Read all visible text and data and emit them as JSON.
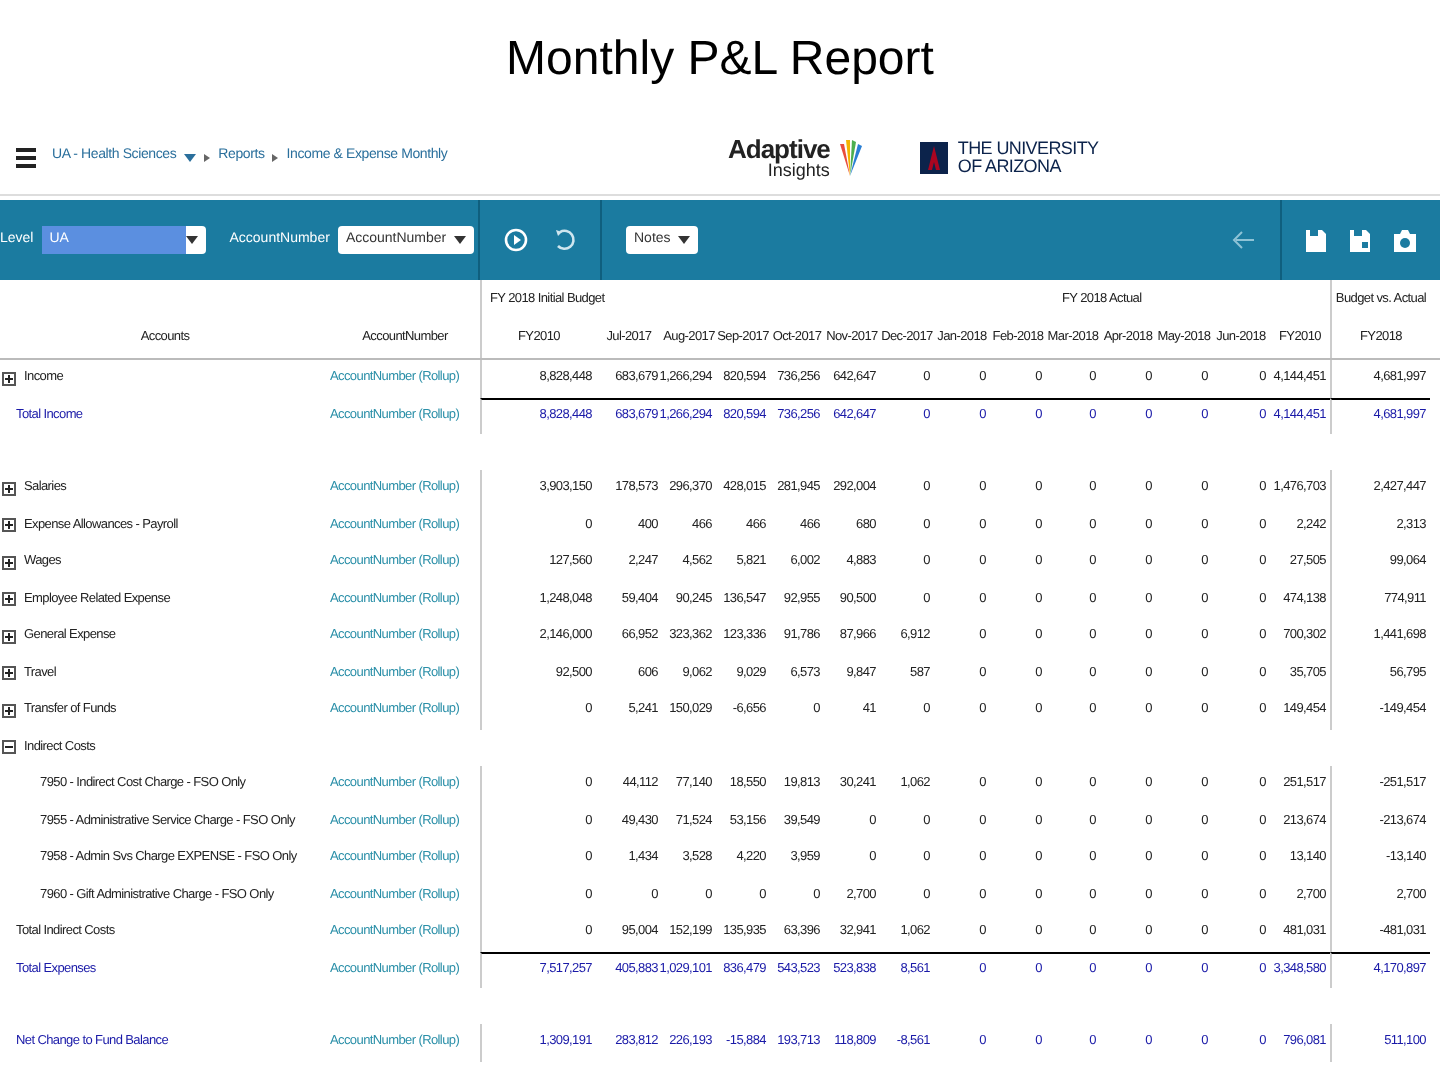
{
  "slide_title": "Monthly P&L Report",
  "header": {
    "breadcrumb": [
      "UA - Health Sciences",
      "Reports",
      "Income & Expense Monthly"
    ],
    "logo_adaptive": [
      "Adaptive",
      "Insights"
    ],
    "logo_university": [
      "THE UNIVERSITY",
      "OF ARIZONA"
    ]
  },
  "toolbar": {
    "level_label": "Level",
    "level_value": "UA",
    "account_label": "AccountNumber",
    "account_value": "AccountNumber",
    "notes": "Notes"
  },
  "table": {
    "column_groups": [
      "FY 2018 Initial Budget",
      "FY 2018 Actual",
      "Budget vs. Actual"
    ],
    "columns": [
      "Accounts",
      "AccountNumber",
      "FY2010",
      "Jul-2017",
      "Aug-2017",
      "Sep-2017",
      "Oct-2017",
      "Nov-2017",
      "Dec-2017",
      "Jan-2018",
      "Feb-2018",
      "Mar-2018",
      "Apr-2018",
      "May-2018",
      "Jun-2018",
      "FY2010",
      "FY2018"
    ],
    "rows": [
      {
        "kind": "group",
        "expanded": false,
        "account": "Income",
        "number": "AccountNumber (Rollup)",
        "values": [
          "8,828,448",
          "683,679",
          "1,266,294",
          "820,594",
          "736,256",
          "642,647",
          "0",
          "0",
          "0",
          "0",
          "0",
          "0",
          "0",
          "4,144,451",
          "4,681,997"
        ]
      },
      {
        "kind": "total",
        "rule_above": true,
        "account": "Total Income",
        "number": "AccountNumber (Rollup)",
        "values": [
          "8,828,448",
          "683,679",
          "1,266,294",
          "820,594",
          "736,256",
          "642,647",
          "0",
          "0",
          "0",
          "0",
          "0",
          "0",
          "0",
          "4,144,451",
          "4,681,997"
        ]
      },
      {
        "kind": "group",
        "gap_before": true,
        "expanded": false,
        "account": "Salaries",
        "number": "AccountNumber (Rollup)",
        "values": [
          "3,903,150",
          "178,573",
          "296,370",
          "428,015",
          "281,945",
          "292,004",
          "0",
          "0",
          "0",
          "0",
          "0",
          "0",
          "0",
          "1,476,703",
          "2,427,447"
        ]
      },
      {
        "kind": "group",
        "expanded": false,
        "account": "Expense Allowances - Payroll",
        "number": "AccountNumber (Rollup)",
        "values": [
          "0",
          "400",
          "466",
          "466",
          "466",
          "680",
          "0",
          "0",
          "0",
          "0",
          "0",
          "0",
          "0",
          "2,242",
          "2,313"
        ]
      },
      {
        "kind": "group",
        "expanded": false,
        "account": "Wages",
        "number": "AccountNumber (Rollup)",
        "values": [
          "127,560",
          "2,247",
          "4,562",
          "5,821",
          "6,002",
          "4,883",
          "0",
          "0",
          "0",
          "0",
          "0",
          "0",
          "0",
          "27,505",
          "99,064"
        ]
      },
      {
        "kind": "group",
        "expanded": false,
        "account": "Employee Related Expense",
        "number": "AccountNumber (Rollup)",
        "values": [
          "1,248,048",
          "59,404",
          "90,245",
          "136,547",
          "92,955",
          "90,500",
          "0",
          "0",
          "0",
          "0",
          "0",
          "0",
          "0",
          "474,138",
          "774,911"
        ]
      },
      {
        "kind": "group",
        "expanded": false,
        "account": "General Expense",
        "number": "AccountNumber (Rollup)",
        "values": [
          "2,146,000",
          "66,952",
          "323,362",
          "123,336",
          "91,786",
          "87,966",
          "6,912",
          "0",
          "0",
          "0",
          "0",
          "0",
          "0",
          "700,302",
          "1,441,698"
        ]
      },
      {
        "kind": "group",
        "expanded": false,
        "account": "Travel",
        "number": "AccountNumber (Rollup)",
        "values": [
          "92,500",
          "606",
          "9,062",
          "9,029",
          "6,573",
          "9,847",
          "587",
          "0",
          "0",
          "0",
          "0",
          "0",
          "0",
          "35,705",
          "56,795"
        ]
      },
      {
        "kind": "group",
        "expanded": false,
        "account": "Transfer of Funds",
        "number": "AccountNumber (Rollup)",
        "values": [
          "0",
          "5,241",
          "150,029",
          "-6,656",
          "0",
          "41",
          "0",
          "0",
          "0",
          "0",
          "0",
          "0",
          "0",
          "149,454",
          "-149,454"
        ]
      },
      {
        "kind": "group",
        "expanded": true,
        "account": "Indirect Costs"
      },
      {
        "kind": "child",
        "account": "7950 - Indirect Cost Charge - FSO Only",
        "number": "AccountNumber (Rollup)",
        "values": [
          "0",
          "44,112",
          "77,140",
          "18,550",
          "19,813",
          "30,241",
          "1,062",
          "0",
          "0",
          "0",
          "0",
          "0",
          "0",
          "251,517",
          "-251,517"
        ]
      },
      {
        "kind": "child",
        "account": "7955 - Administrative Service Charge - FSO Only",
        "number": "AccountNumber (Rollup)",
        "values": [
          "0",
          "49,430",
          "71,524",
          "53,156",
          "39,549",
          "0",
          "0",
          "0",
          "0",
          "0",
          "0",
          "0",
          "0",
          "213,674",
          "-213,674"
        ]
      },
      {
        "kind": "child",
        "account": "7958 - Admin Svs Charge EXPENSE - FSO Only",
        "number": "AccountNumber (Rollup)",
        "values": [
          "0",
          "1,434",
          "3,528",
          "4,220",
          "3,959",
          "0",
          "0",
          "0",
          "0",
          "0",
          "0",
          "0",
          "0",
          "13,140",
          "-13,140"
        ]
      },
      {
        "kind": "child",
        "account": "7960 - Gift Administrative Charge - FSO Only",
        "number": "AccountNumber (Rollup)",
        "values": [
          "0",
          "0",
          "0",
          "0",
          "0",
          "2,700",
          "0",
          "0",
          "0",
          "0",
          "0",
          "0",
          "0",
          "2,700",
          "2,700"
        ]
      },
      {
        "kind": "subtotal",
        "account": "Total Indirect Costs",
        "number": "AccountNumber (Rollup)",
        "values": [
          "0",
          "95,004",
          "152,199",
          "135,935",
          "63,396",
          "32,941",
          "1,062",
          "0",
          "0",
          "0",
          "0",
          "0",
          "0",
          "481,031",
          "-481,031"
        ]
      },
      {
        "kind": "total",
        "rule_above": true,
        "account": "Total Expenses",
        "number": "AccountNumber (Rollup)",
        "values": [
          "7,517,257",
          "405,883",
          "1,029,101",
          "836,479",
          "543,523",
          "523,838",
          "8,561",
          "0",
          "0",
          "0",
          "0",
          "0",
          "0",
          "3,348,580",
          "4,170,897"
        ]
      },
      {
        "kind": "total",
        "gap_before": true,
        "account": "Net Change to Fund Balance",
        "number": "AccountNumber (Rollup)",
        "values": [
          "1,309,191",
          "283,812",
          "226,193",
          "-15,884",
          "193,713",
          "118,809",
          "-8,561",
          "0",
          "0",
          "0",
          "0",
          "0",
          "0",
          "796,081",
          "511,100"
        ]
      }
    ]
  }
}
